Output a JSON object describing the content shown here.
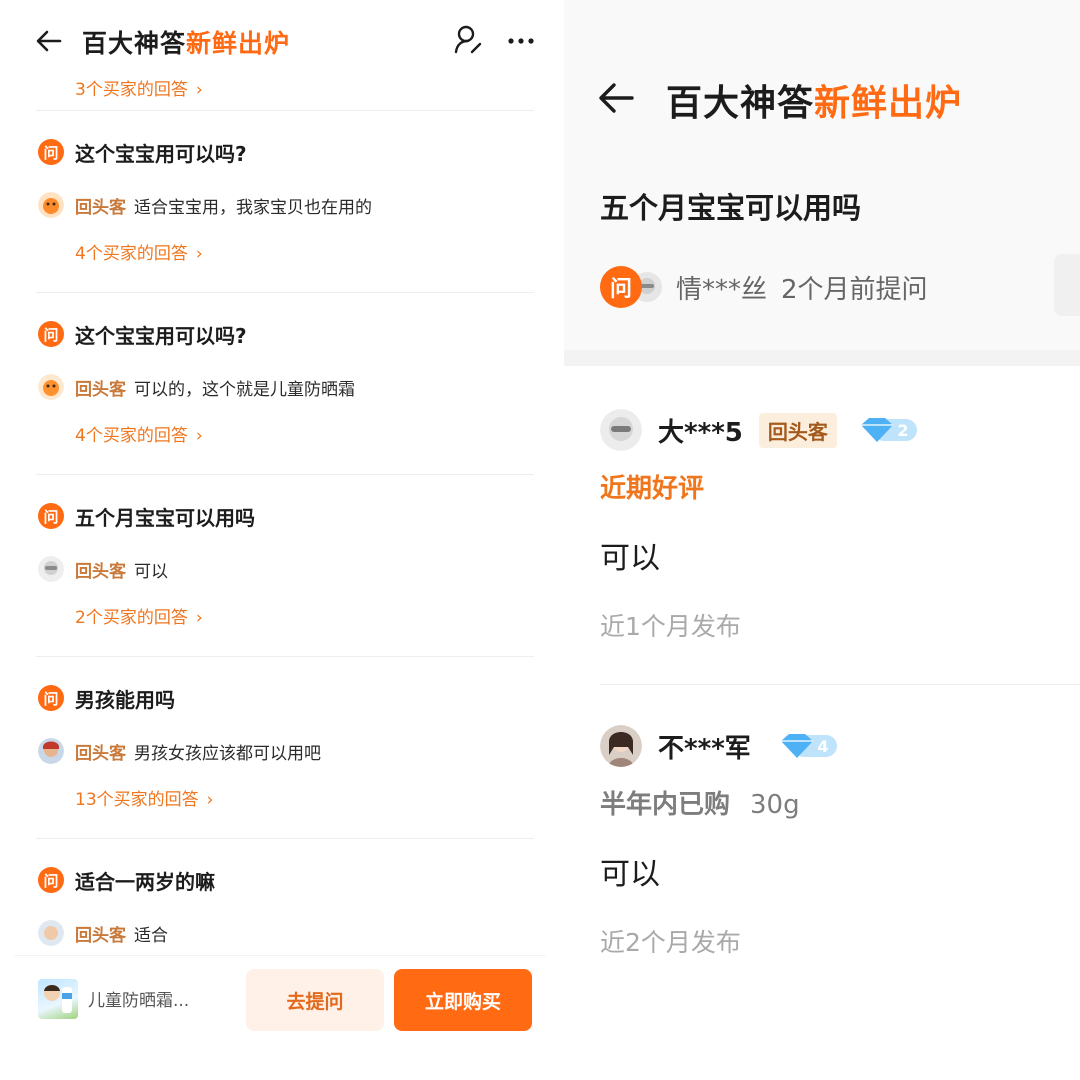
{
  "left": {
    "title_dark": "百大神答",
    "title_orange": "新鲜出炉",
    "top_count": "3个买家的回答",
    "qa": [
      {
        "question": "这个宝宝用可以吗?",
        "tag": "回头客",
        "answer": "适合宝宝用，我家宝贝也在用的",
        "count": "4个买家的回答"
      },
      {
        "question": "这个宝宝用可以吗?",
        "tag": "回头客",
        "answer": "可以的，这个就是儿童防晒霜",
        "count": "4个买家的回答"
      },
      {
        "question": "五个月宝宝可以用吗",
        "tag": "回头客",
        "answer": "可以",
        "count": "2个买家的回答"
      },
      {
        "question": "男孩能用吗",
        "tag": "回头客",
        "answer": "男孩女孩应该都可以用吧",
        "count": "13个买家的回答"
      },
      {
        "question": "适合一两岁的嘛",
        "tag": "回头客",
        "answer": "适合",
        "count": ""
      }
    ],
    "q_badge": "问",
    "bottom": {
      "product_name": "儿童防晒霜...",
      "ask_label": "去提问",
      "buy_label": "立即购买"
    }
  },
  "right": {
    "title_dark": "百大神答",
    "title_orange": "新鲜出炉",
    "question": "五个月宝宝可以用吗",
    "q_badge": "问",
    "asker_name": "情***丝",
    "asker_time": "2个月前提问",
    "answers": [
      {
        "name": "大***5",
        "tag": "回头客",
        "level": "2",
        "sub": "近期好评",
        "body": "可以",
        "time": "近1个月发布"
      },
      {
        "name": "不***军",
        "level": "4",
        "sub_tag": "半年内已购",
        "sub_spec": "30g",
        "body": "可以",
        "time": "近2个月发布"
      }
    ]
  },
  "colors": {
    "accent": "#ff6a13",
    "link": "#f0761e",
    "tag": "#c9793a"
  }
}
